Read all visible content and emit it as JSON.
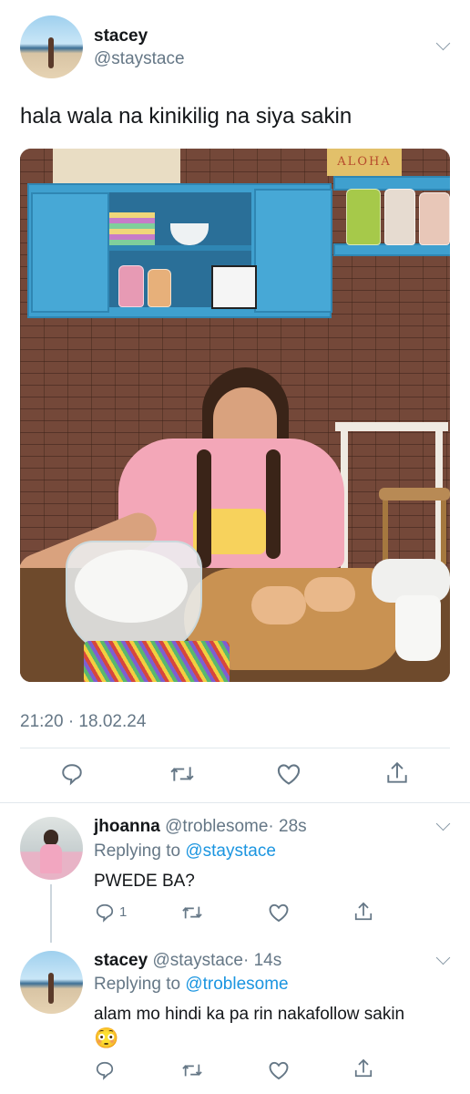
{
  "tweet": {
    "author_name": "stacey",
    "author_handle": "@staystace",
    "text": "hala wala na kinikilig na siya sakin",
    "timestamp": "21:20 · 18.02.24",
    "sign_text": "ALOHA"
  },
  "replies": [
    {
      "author_name": "jhoanna",
      "author_handle": "@troblesome",
      "time": "· 28s",
      "replying_label": "Replying to",
      "replying_to": "@staystace",
      "text": "PWEDE BA?",
      "reply_count": "1"
    },
    {
      "author_name": "stacey",
      "author_handle": "@staystace",
      "time": "· 14s",
      "replying_label": "Replying to",
      "replying_to": "@troblesome",
      "text": "alam mo hindi ka pa rin nakafollow sakin",
      "emoji": "😳"
    }
  ],
  "icons": [
    "reply-icon",
    "retweet-icon",
    "like-icon",
    "share-icon",
    "chevron-down-icon"
  ],
  "colors": {
    "link": "#1b95e0",
    "secondary_text": "#657786",
    "divider": "#e1e8ed",
    "icon": "#657786"
  }
}
